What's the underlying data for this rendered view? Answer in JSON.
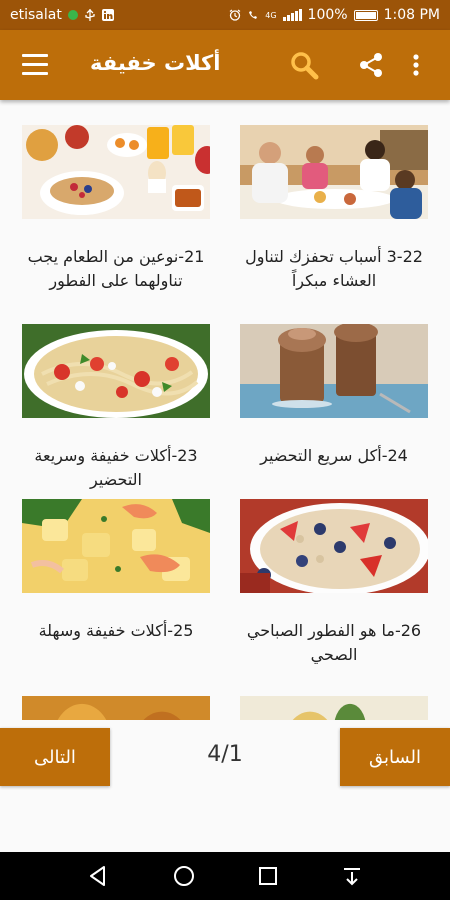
{
  "status_bar": {
    "carrier": "etisalat",
    "battery": "100%",
    "time": "1:08 PM",
    "network_type": "4G"
  },
  "app_bar": {
    "title": "أكلات خفيفة",
    "icons": [
      "menu-icon",
      "search-icon",
      "share-icon",
      "more-vert-icon"
    ]
  },
  "articles": [
    {
      "title": "3-22 أسباب تحفزك لتناول العشاء مبكراً",
      "image": "family-dinner"
    },
    {
      "title": "21-نوعين من الطعام يجب تناولهما على الفطور",
      "image": "breakfast-spread"
    },
    {
      "title": "24-أكل سريع التحضير",
      "image": "chocolate-mousse-cups"
    },
    {
      "title": "23-أكلات خفيفة وسريعة التحضير",
      "image": "pasta-salad"
    },
    {
      "title": "26-ما هو الفطور الصباحي الصحي",
      "image": "oatmeal-berries"
    },
    {
      "title": "25-أكلات خفيفة وسهلة",
      "image": "shrimp-potatoes"
    }
  ],
  "pagination": {
    "next_label": "التالى",
    "prev_label": "السابق",
    "indicator": "4/1"
  },
  "colors": {
    "status_bar": "#9c5408",
    "app_bar": "#bd6e0a",
    "button": "#bd6e0a",
    "background": "#fafafa",
    "nav_bar": "#000000"
  },
  "system_nav": [
    "back-icon",
    "home-icon",
    "recents-icon",
    "notification-pull-icon"
  ]
}
